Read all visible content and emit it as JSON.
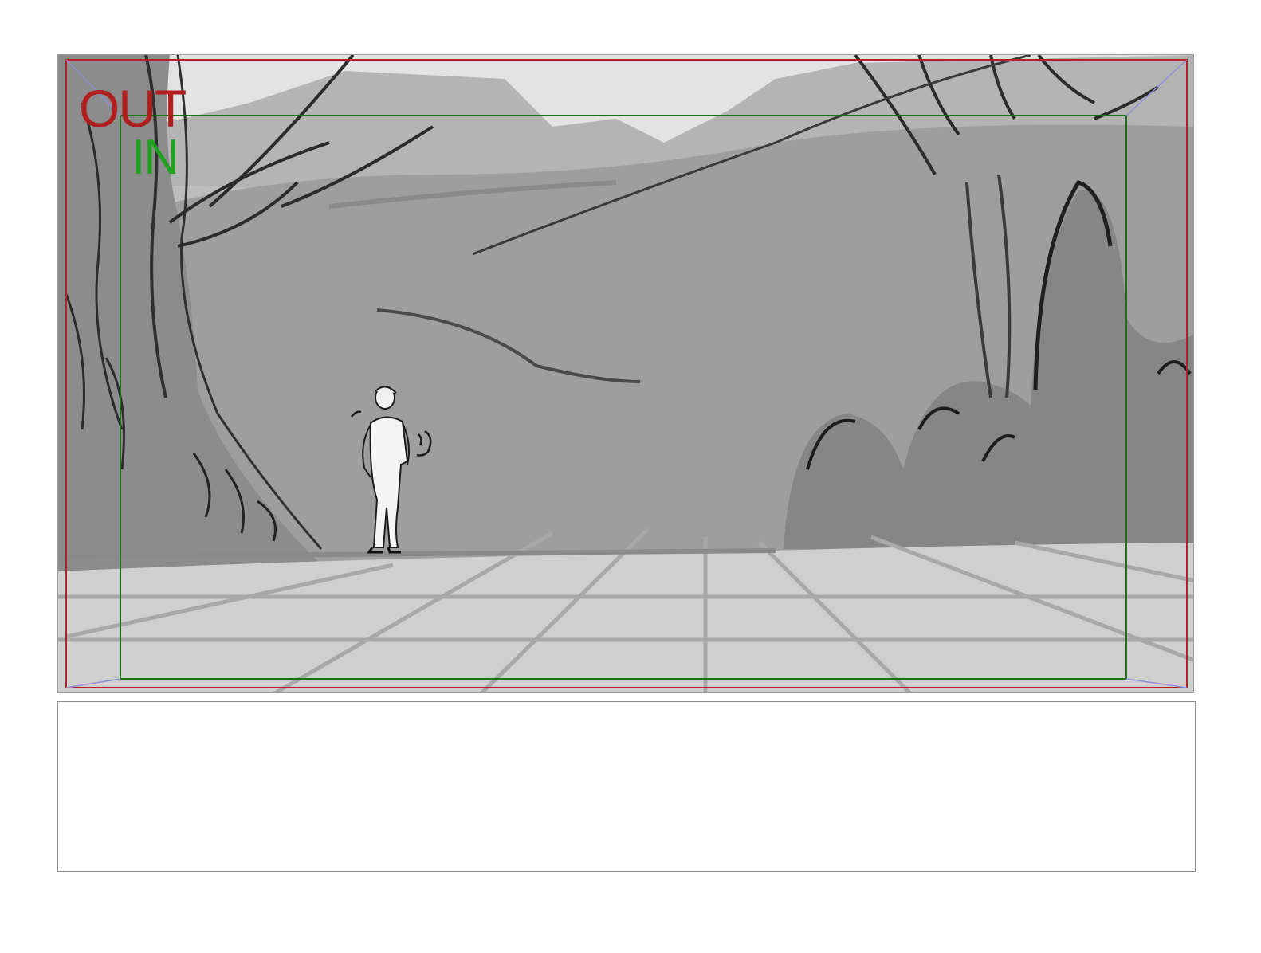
{
  "panel": {
    "out_label": "OUT",
    "in_label": "IN",
    "out_color": "#b01e1e",
    "in_color": "#1fa01f",
    "outer_frame_color": "#b22222",
    "inner_frame_color": "#1e6e1e",
    "corner_marker_color": "#8f8fd8",
    "background_icon": "forest-clearing-sketch",
    "character_icon": "standing-man-sketch"
  },
  "notes": {
    "text": ""
  }
}
